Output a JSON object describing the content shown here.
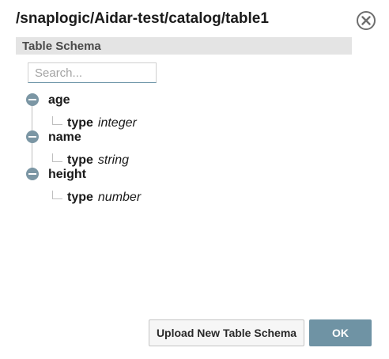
{
  "dialog": {
    "title": "/snaplogic/Aidar-test/catalog/table1",
    "close_icon": "close-circle-icon"
  },
  "section": {
    "title": "Table Schema"
  },
  "search": {
    "placeholder": "Search...",
    "value": ""
  },
  "tree": {
    "nodes": [
      {
        "label": "age",
        "child_key": "type",
        "child_value": "integer",
        "expanded": true
      },
      {
        "label": "name",
        "child_key": "type",
        "child_value": "string",
        "expanded": true
      },
      {
        "label": "height",
        "child_key": "type",
        "child_value": "number",
        "expanded": true
      }
    ]
  },
  "footer": {
    "upload_label": "Upload New Table Schema",
    "ok_label": "OK"
  },
  "colors": {
    "accent": "#6f93a4",
    "section_bg": "#e4e4e4",
    "toggle": "#7b96a4"
  }
}
